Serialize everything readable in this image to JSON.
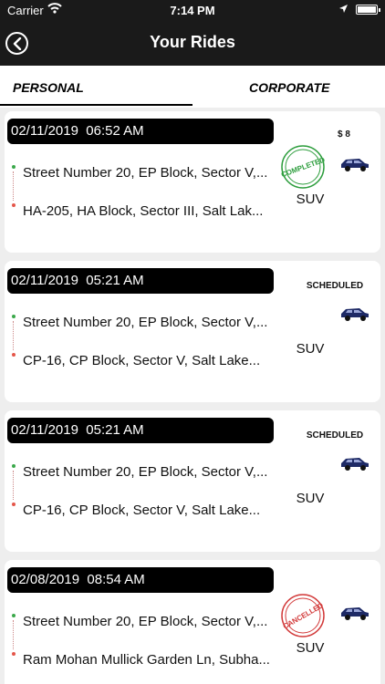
{
  "status_bar": {
    "carrier": "Carrier",
    "time": "7:14 PM",
    "icons": [
      "wifi-icon",
      "location-arrow-icon",
      "battery-icon"
    ]
  },
  "nav": {
    "title": "Your Rides",
    "back_icon": "back-arrow-circle-icon"
  },
  "tabs": {
    "personal": "PERSONAL",
    "corporate": "CORPORATE",
    "selected": "personal"
  },
  "rides": [
    {
      "datetime": "02/11/2019  06:52 AM",
      "from": "Street Number 20, EP Block, Sector V,...",
      "to": "HA-205, HA Block, Sector III, Salt Lak...",
      "vehicle": "SUV",
      "fare": "$ 8",
      "stamp": "COMPLETED",
      "stamp_color": "#2e9e3e"
    },
    {
      "datetime": "02/11/2019  05:21 AM",
      "from": "Street Number 20, EP Block, Sector V,...",
      "to": "CP-16, CP Block, Sector V, Salt Lake...",
      "vehicle": "SUV",
      "status": "SCHEDULED"
    },
    {
      "datetime": "02/11/2019  05:21 AM",
      "from": "Street Number 20, EP Block, Sector V,...",
      "to": "CP-16, CP Block, Sector V, Salt Lake...",
      "vehicle": "SUV",
      "status": "SCHEDULED"
    },
    {
      "datetime": "02/08/2019  08:54 AM",
      "from": "Street Number 20, EP Block, Sector V,...",
      "to": "Ram Mohan Mullick Garden Ln, Subha...",
      "vehicle": "SUV",
      "stamp": "CANCELLED",
      "stamp_color": "#d23a3a"
    }
  ],
  "colors": {
    "header_bg": "#1a1a1a",
    "list_bg": "#eeeeee",
    "pickup_dot": "#3aa84a",
    "drop_dot": "#e4564a",
    "car_body": "#1e2a66"
  }
}
